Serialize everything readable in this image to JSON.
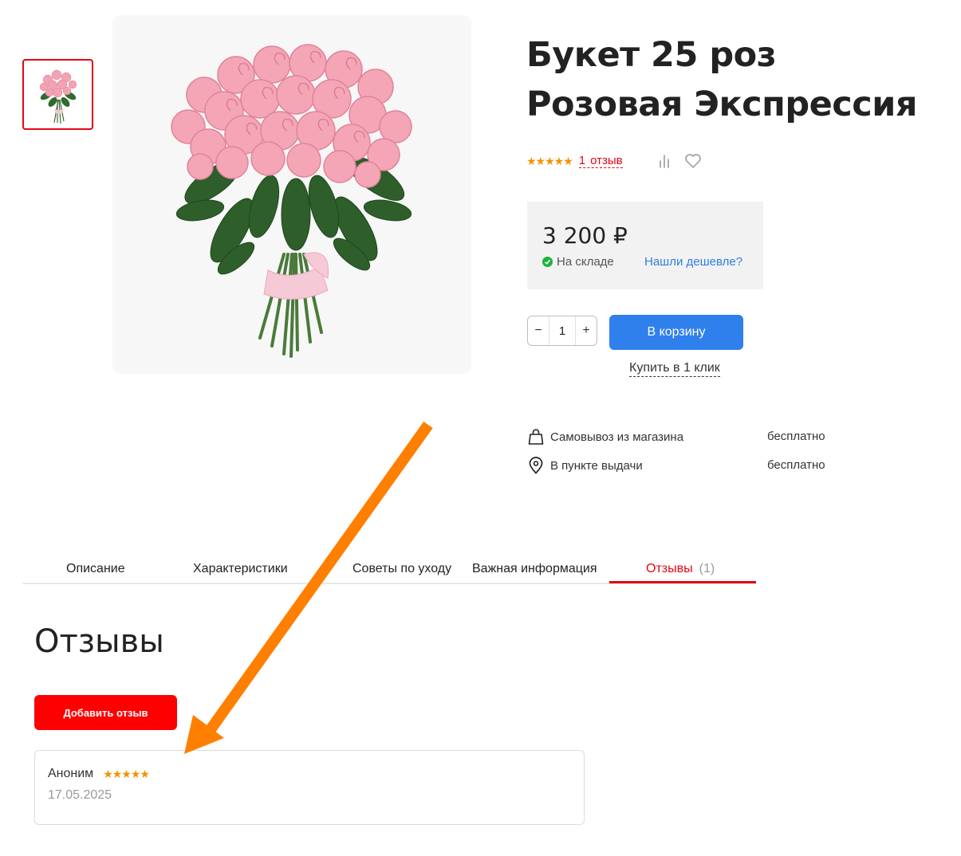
{
  "product": {
    "title": "Букет 25 роз Розовая Экспрессия",
    "rating_stars": "★★★★★",
    "review_count": "1",
    "review_word": "отзыв",
    "price": "3 200 ₽",
    "stock": "На складе",
    "cheaper_link": "Нашли дешевле?",
    "quantity": "1",
    "qty_minus": "−",
    "qty_plus": "+",
    "add_to_cart": "В корзину",
    "buy_one_click": "Купить в 1 клик"
  },
  "icons": {
    "compare": "compare-icon",
    "favorite": "heart-icon",
    "pickup": "shopping-bag-icon",
    "point": "map-pin-icon",
    "stock": "check-circle-icon"
  },
  "delivery": [
    {
      "label": "Самовывоз из магазина",
      "price": "бесплатно"
    },
    {
      "label": "В пункте выдачи",
      "price": "бесплатно"
    }
  ],
  "tabs": [
    {
      "label": "Описание"
    },
    {
      "label": "Характеристики"
    },
    {
      "label": "Советы по уходу"
    },
    {
      "label": "Важная информация"
    },
    {
      "label": "Отзывы",
      "count": "(1)",
      "active": true
    }
  ],
  "reviews": {
    "heading": "Отзывы",
    "add_button": "Добавить отзыв",
    "items": [
      {
        "author": "Аноним",
        "stars": "★★★★★",
        "date": "17.05.2025"
      }
    ]
  },
  "colors": {
    "accent_red": "#e30613",
    "button_blue": "#2f80ed",
    "star_orange": "#f39200",
    "annotation_arrow": "#ff7f00"
  }
}
